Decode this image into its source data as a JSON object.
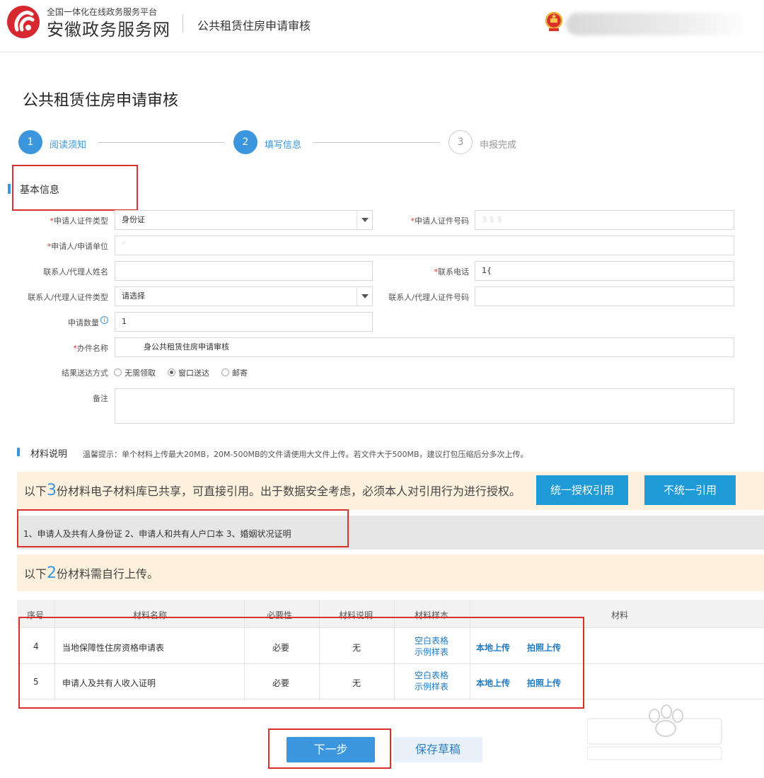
{
  "header": {
    "platform_subtitle": "全国一体化在线政务服务平台",
    "site_name": "安徽政务服务网",
    "page_name": "公共租赁住房申请审核"
  },
  "page_title": "公共租赁住房申请审核",
  "steps": [
    {
      "number": "1",
      "label": "阅读须知"
    },
    {
      "number": "2",
      "label": "填写信息"
    },
    {
      "number": "3",
      "label": "申报完成"
    }
  ],
  "basic_info": {
    "title": "基本信息",
    "applicant_id_type": {
      "label": "申请人证件类型",
      "value": "身份证"
    },
    "applicant_id_number": {
      "label": "申请人证件号码",
      "value": "3 1 3"
    },
    "applicant_name": {
      "label": "申请人/申请单位",
      "value": "\""
    },
    "contact_name": {
      "label": "联系人/代理人姓名",
      "value": ""
    },
    "contact_phone": {
      "label": "联系电话",
      "value": "1{"
    },
    "contact_id_type": {
      "label": "联系人/代理人证件类型",
      "value": "请选择"
    },
    "contact_id_number": {
      "label": "联系人/代理人证件号码",
      "value": ""
    },
    "quantity": {
      "label": "申请数量",
      "value": "1"
    },
    "case_name": {
      "label": "办件名称",
      "value": "身公共租赁住房申请审核"
    },
    "delivery": {
      "label": "结果送达方式",
      "options": [
        "无需领取",
        "窗口送达",
        "邮寄"
      ],
      "selected": "窗口送达"
    },
    "remarks": {
      "label": "备注",
      "value": ""
    }
  },
  "materials": {
    "title": "材料说明",
    "hint": "温馨提示：单个材料上传最大20MB，20M-500MB的文件请使用大文件上传。若文件大于500MB，建议打包压缩后分多次上传。",
    "shared_banner": {
      "prefix": "以下",
      "count": "3",
      "suffix": "份材料电子材料库已共享，可直接引用。出于数据安全考虑，必须本人对引用行为进行授权。"
    },
    "authorize_button": "统一授权引用",
    "no_authorize_button": "不统一引用",
    "shared_list": "1、申请人及共有人身份证   2、申请人和共有人户口本   3、婚姻状况证明",
    "upload_banner": {
      "prefix": "以下",
      "count": "2",
      "suffix": "份材料需自行上传。"
    },
    "table": {
      "headers": [
        "序号",
        "材料名称",
        "必要性",
        "材料说明",
        "材料样本",
        "材料"
      ],
      "rows": [
        {
          "no": "4",
          "name": "当地保障性住房资格申请表",
          "required": "必要",
          "desc": "无",
          "sample_blank": "空白表格",
          "sample_example": "示例样表",
          "local_upload": "本地上传",
          "photo_upload": "拍照上传"
        },
        {
          "no": "5",
          "name": "申请人及共有人收入证明",
          "required": "必要",
          "desc": "无",
          "sample_blank": "空白表格",
          "sample_example": "示例样表",
          "local_upload": "本地上传",
          "photo_upload": "拍照上传"
        }
      ]
    }
  },
  "actions": {
    "next": "下一步",
    "save_draft": "保存草稿"
  },
  "colors": {
    "accent": "#3b96de",
    "highlight_box": "#d9312c",
    "banner_bg": "#fdf0dc",
    "logo_red": "#d7282f"
  }
}
